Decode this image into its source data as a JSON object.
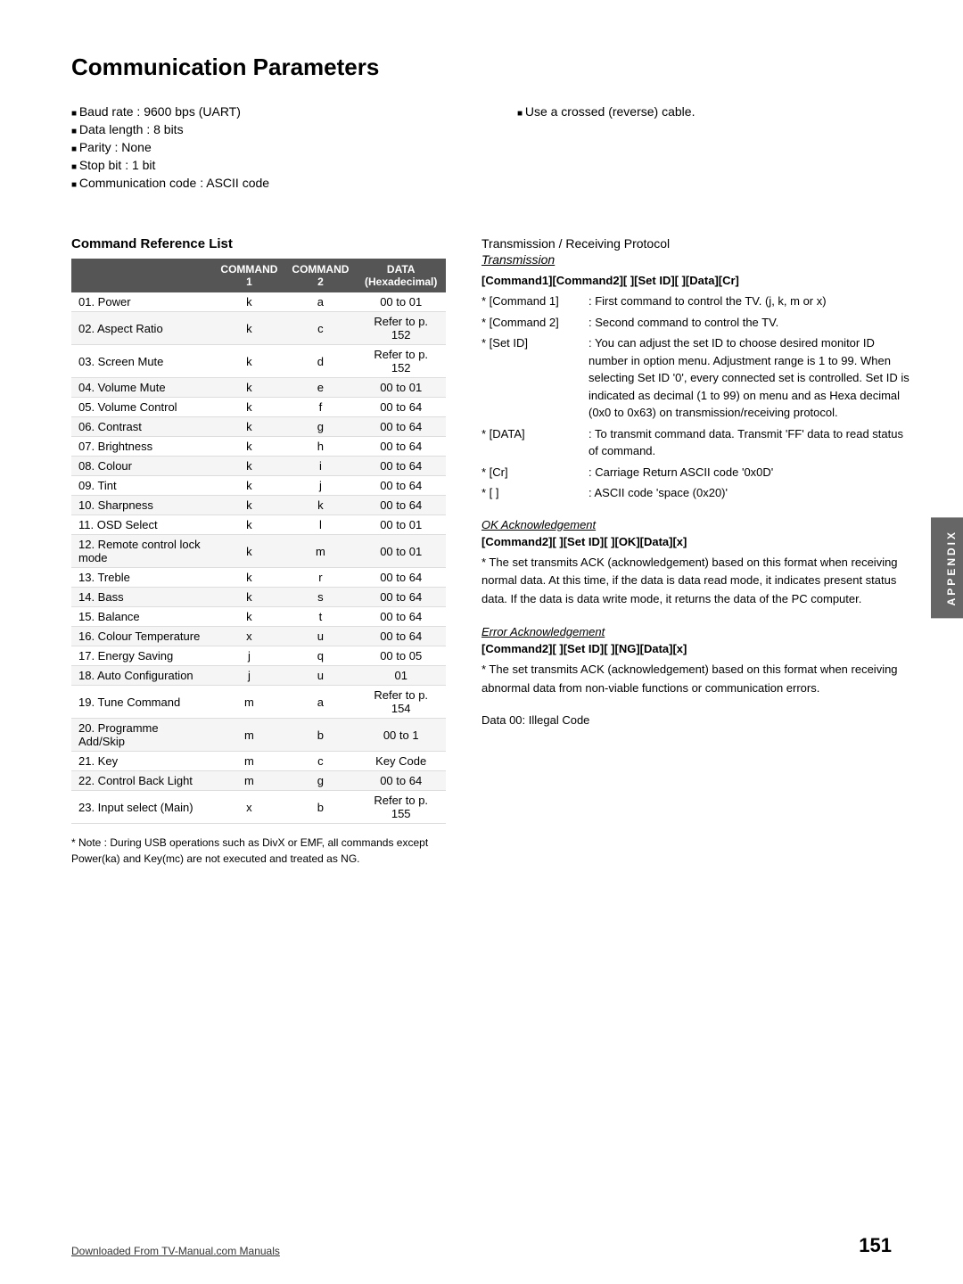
{
  "page": {
    "title": "Communication Parameters",
    "bullets_left": [
      "Baud rate : 9600 bps (UART)",
      "Data length : 8 bits",
      "Parity : None",
      "Stop bit : 1 bit",
      "Communication code : ASCII code"
    ],
    "bullets_right": [
      "Use a crossed (reverse) cable."
    ],
    "command_reference": {
      "title": "Command Reference List",
      "columns": [
        "COMMAND 1",
        "COMMAND 2",
        "DATA (Hexadecimal)"
      ],
      "rows": [
        {
          "name": "01. Power",
          "cmd1": "k",
          "cmd2": "a",
          "data": "00 to 01"
        },
        {
          "name": "02. Aspect Ratio",
          "cmd1": "k",
          "cmd2": "c",
          "data": "Refer to p. 152"
        },
        {
          "name": "03. Screen Mute",
          "cmd1": "k",
          "cmd2": "d",
          "data": "Refer to p. 152"
        },
        {
          "name": "04. Volume Mute",
          "cmd1": "k",
          "cmd2": "e",
          "data": "00 to 01"
        },
        {
          "name": "05. Volume Control",
          "cmd1": "k",
          "cmd2": "f",
          "data": "00 to 64"
        },
        {
          "name": "06. Contrast",
          "cmd1": "k",
          "cmd2": "g",
          "data": "00 to 64"
        },
        {
          "name": "07. Brightness",
          "cmd1": "k",
          "cmd2": "h",
          "data": "00 to 64"
        },
        {
          "name": "08. Colour",
          "cmd1": "k",
          "cmd2": "i",
          "data": "00 to 64"
        },
        {
          "name": "09. Tint",
          "cmd1": "k",
          "cmd2": "j",
          "data": "00 to 64"
        },
        {
          "name": "10. Sharpness",
          "cmd1": "k",
          "cmd2": "k",
          "data": "00 to 64"
        },
        {
          "name": "11. OSD Select",
          "cmd1": "k",
          "cmd2": "l",
          "data": "00 to 01"
        },
        {
          "name": "12. Remote control lock mode",
          "cmd1": "k",
          "cmd2": "m",
          "data": "00 to 01"
        },
        {
          "name": "13. Treble",
          "cmd1": "k",
          "cmd2": "r",
          "data": "00 to 64"
        },
        {
          "name": "14. Bass",
          "cmd1": "k",
          "cmd2": "s",
          "data": "00 to 64"
        },
        {
          "name": "15. Balance",
          "cmd1": "k",
          "cmd2": "t",
          "data": "00 to 64"
        },
        {
          "name": "16. Colour Temperature",
          "cmd1": "x",
          "cmd2": "u",
          "data": "00 to 64"
        },
        {
          "name": "17. Energy Saving",
          "cmd1": "j",
          "cmd2": "q",
          "data": "00 to 05"
        },
        {
          "name": "18. Auto Configuration",
          "cmd1": "j",
          "cmd2": "u",
          "data": "01"
        },
        {
          "name": "19. Tune Command",
          "cmd1": "m",
          "cmd2": "a",
          "data": "Refer to p. 154"
        },
        {
          "name": "20. Programme Add/Skip",
          "cmd1": "m",
          "cmd2": "b",
          "data": "00 to 1"
        },
        {
          "name": "21. Key",
          "cmd1": "m",
          "cmd2": "c",
          "data": "Key Code"
        },
        {
          "name": "22. Control Back Light",
          "cmd1": "m",
          "cmd2": "g",
          "data": "00 to 64"
        },
        {
          "name": "23. Input select (Main)",
          "cmd1": "x",
          "cmd2": "b",
          "data": "Refer to p. 155"
        }
      ],
      "footnote": "* Note : During USB operations such as DivX or EMF, all commands except Power(ka) and Key(mc) are not executed and treated as NG."
    },
    "transmission": {
      "section_title": "Transmission / Receiving Protocol",
      "subsection_title": "Transmission",
      "cmd_format": "[Command1][Command2][  ][Set ID][  ][Data][Cr]",
      "protocol_items": [
        {
          "label": "* [Command 1]",
          "desc": ": First command to control the TV. (j, k, m or x)"
        },
        {
          "label": "* [Command 2]",
          "desc": ": Second command to control the TV."
        },
        {
          "label": "* [Set ID]",
          "desc": ": You can adjust the set ID to choose desired monitor ID number in option menu. Adjustment range is 1 to 99. When selecting Set ID '0', every connected set is controlled. Set ID is indicated as decimal (1 to 99) on menu and as Hexa decimal (0x0 to 0x63) on transmission/receiving protocol."
        },
        {
          "label": "* [DATA]",
          "desc": ": To transmit command data. Transmit 'FF' data to read status of command."
        },
        {
          "label": "* [Cr]",
          "desc": ": Carriage Return ASCII code '0x0D'"
        },
        {
          "label": "* [  ]",
          "desc": ": ASCII code 'space (0x20)'"
        }
      ],
      "ok_ack": {
        "title": "OK Acknowledgement",
        "cmd_format": "[Command2][  ][Set ID][  ][OK][Data][x]",
        "desc": "* The set transmits ACK (acknowledgement) based on this format when receiving normal data. At this time, if the data is data read mode, it indicates present status data. If the data is data write mode, it returns the data of the PC computer."
      },
      "error_ack": {
        "title": "Error Acknowledgement",
        "cmd_format": "[Command2][  ][Set ID][  ][NG][Data][x]",
        "desc": "* The set transmits ACK (acknowledgement) based on this format when receiving abnormal data from non-viable functions or communication errors.",
        "data_note": "Data 00: Illegal Code"
      }
    },
    "appendix_label": "APPENDIX",
    "page_number": "151",
    "footer_link": "Downloaded From TV-Manual.com Manuals"
  }
}
